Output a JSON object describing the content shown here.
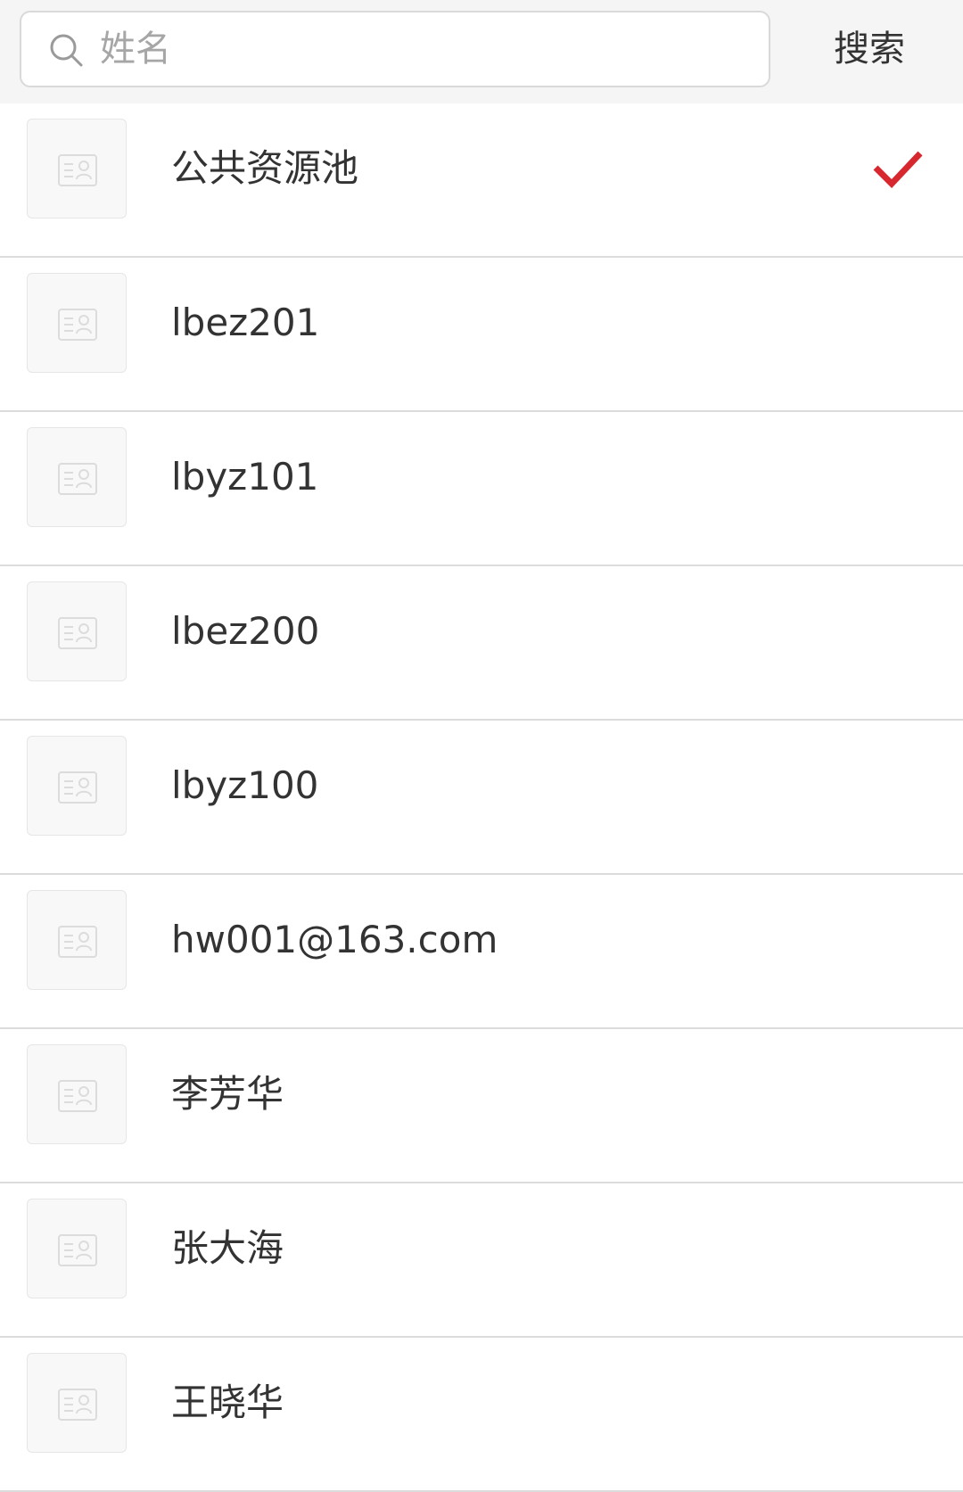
{
  "search": {
    "placeholder": "姓名",
    "value": "",
    "button_label": "搜索",
    "icon": "search-icon"
  },
  "colors": {
    "accent_check": "#d7282f",
    "header_bg": "#f5f5f5",
    "divider": "#dcdcdc",
    "text": "#333333",
    "placeholder": "#a6a6a6"
  },
  "list": {
    "items": [
      {
        "name": "公共资源池",
        "selected": true,
        "icon": "contact-card-icon"
      },
      {
        "name": "lbez201",
        "selected": false,
        "icon": "contact-card-icon"
      },
      {
        "name": "lbyz101",
        "selected": false,
        "icon": "contact-card-icon"
      },
      {
        "name": "lbez200",
        "selected": false,
        "icon": "contact-card-icon"
      },
      {
        "name": "lbyz100",
        "selected": false,
        "icon": "contact-card-icon"
      },
      {
        "name": "hw001@163.com",
        "selected": false,
        "icon": "contact-card-icon"
      },
      {
        "name": "李芳华",
        "selected": false,
        "icon": "contact-card-icon"
      },
      {
        "name": "张大海",
        "selected": false,
        "icon": "contact-card-icon"
      },
      {
        "name": "王晓华",
        "selected": false,
        "icon": "contact-card-icon"
      }
    ]
  }
}
